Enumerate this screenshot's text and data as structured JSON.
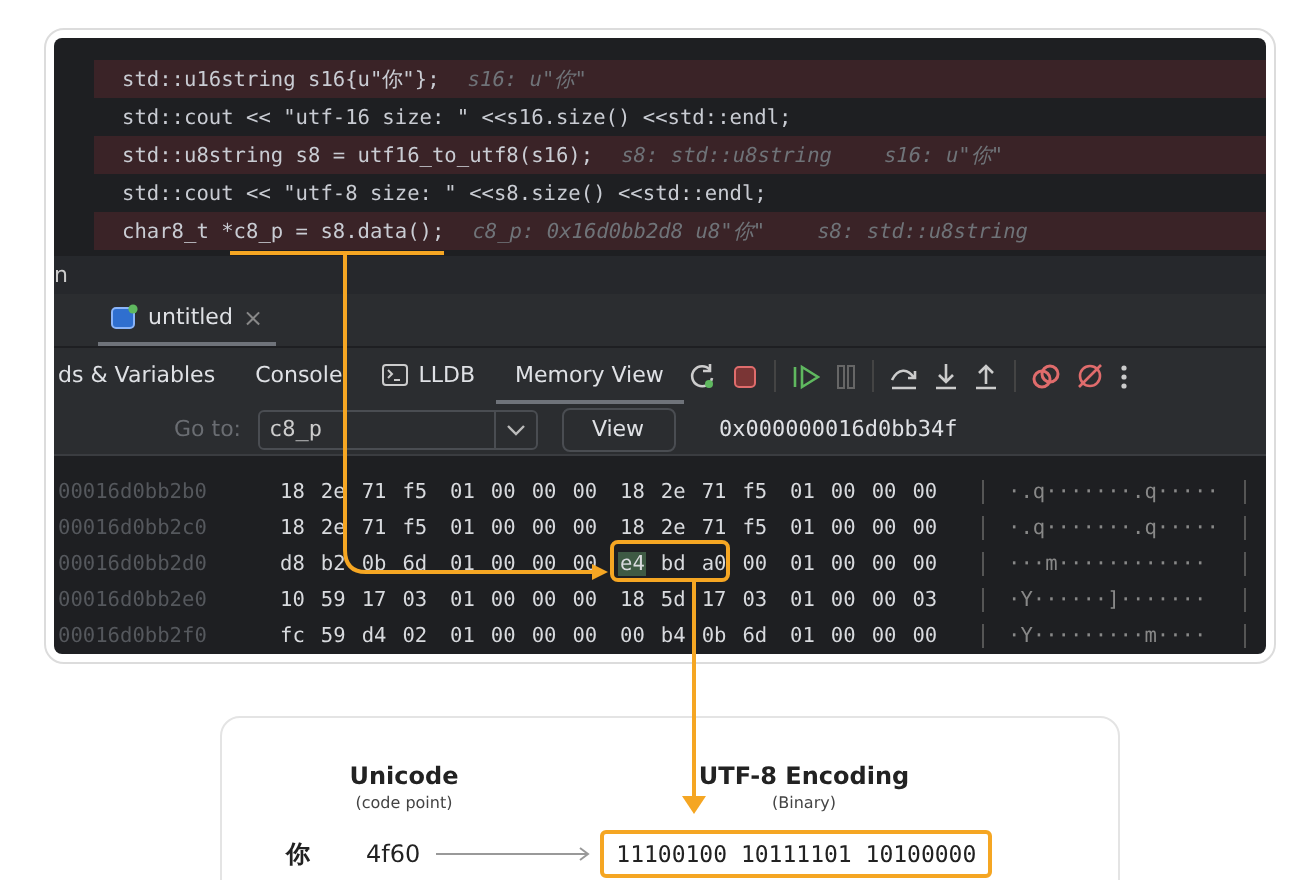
{
  "editor": {
    "lines": [
      {
        "code": "std::u16string s16{u\"你\"};",
        "highlighted": true,
        "hints": [
          "s16: u\"你\""
        ]
      },
      {
        "code": "std::cout << \"utf-16 size: \" <<s16.size() <<std::endl;",
        "highlighted": false
      },
      {
        "code": "std::u8string s8 = utf16_to_utf8(s16);",
        "highlighted": true,
        "hints": [
          "s8: std::u8string",
          "s16: u\"你\""
        ]
      },
      {
        "code": "std::cout << \"utf-8 size: \" <<s8.size() <<std::endl;",
        "highlighted": false
      },
      {
        "code": "char8_t *c8_p = s8.data();",
        "highlighted": true,
        "hints": [
          "c8_p: 0x16d0bb2d8 u8\"你\"",
          "s8: std::u8string"
        ]
      }
    ]
  },
  "panel_label": "n",
  "session_tab": {
    "label": "untitled",
    "close": "×"
  },
  "debug_tabs": [
    {
      "label": "ds & Variables",
      "selected": false
    },
    {
      "label": "Console",
      "selected": false
    },
    {
      "label": "LLDB",
      "selected": false,
      "kind": "terminal"
    },
    {
      "label": "Memory View",
      "selected": true
    }
  ],
  "goto": {
    "label": "Go to:",
    "value": "c8_p",
    "button": "View",
    "address": "0x000000016d0bb34f"
  },
  "memory": [
    {
      "address": "00016d0bb2b0",
      "groups": [
        {
          "bytes": "18 2e 71 f5",
          "cursor": false
        },
        {
          "bytes": "01 00 00 00",
          "cursor": false
        },
        {
          "bytes": "18 2e 71 f5",
          "cursor": false
        },
        {
          "bytes": "01 00 00 00",
          "cursor": false
        }
      ],
      "ascii": "·.q·······.q·····"
    },
    {
      "address": "00016d0bb2c0",
      "groups": [
        {
          "bytes": "18 2e 71 f5",
          "cursor": false
        },
        {
          "bytes": "01 00 00 00",
          "cursor": false
        },
        {
          "bytes": "18 2e 71 f5",
          "cursor": false
        },
        {
          "bytes": "01 00 00 00",
          "cursor": false
        }
      ],
      "ascii": "·.q·······.q·····"
    },
    {
      "address": "00016d0bb2d0",
      "groups": [
        {
          "bytes": "d8 b2 0b 6d",
          "cursor": false
        },
        {
          "bytes": "01 00 00 00",
          "cursor": false
        },
        {
          "bytes": "e4 bd a0 00",
          "cursor": true
        },
        {
          "bytes": "01 00 00 00",
          "cursor": false
        }
      ],
      "ascii": "···m············"
    },
    {
      "address": "00016d0bb2e0",
      "groups": [
        {
          "bytes": "10 59 17 03",
          "cursor": false
        },
        {
          "bytes": "01 00 00 00",
          "cursor": false
        },
        {
          "bytes": "18 5d 17 03",
          "cursor": false
        },
        {
          "bytes": "01 00 00 03",
          "cursor": false
        }
      ],
      "ascii": "·Y······]·······"
    },
    {
      "address": "00016d0bb2f0",
      "groups": [
        {
          "bytes": "fc 59 d4 02",
          "cursor": false
        },
        {
          "bytes": "01 00 00 00",
          "cursor": false
        },
        {
          "bytes": "00 b4 0b 6d",
          "cursor": false
        },
        {
          "bytes": "01 00 00 00",
          "cursor": false
        }
      ],
      "ascii": "·Y·········m····"
    }
  ],
  "encoding_card": {
    "headers": [
      {
        "title": "Unicode",
        "subtitle": "(code point)"
      },
      {
        "title": "UTF-8 Encoding",
        "subtitle": "(Binary)"
      }
    ],
    "row": {
      "char": "你",
      "code": "4f60",
      "binary": "11100100 10111101 10100000"
    }
  }
}
